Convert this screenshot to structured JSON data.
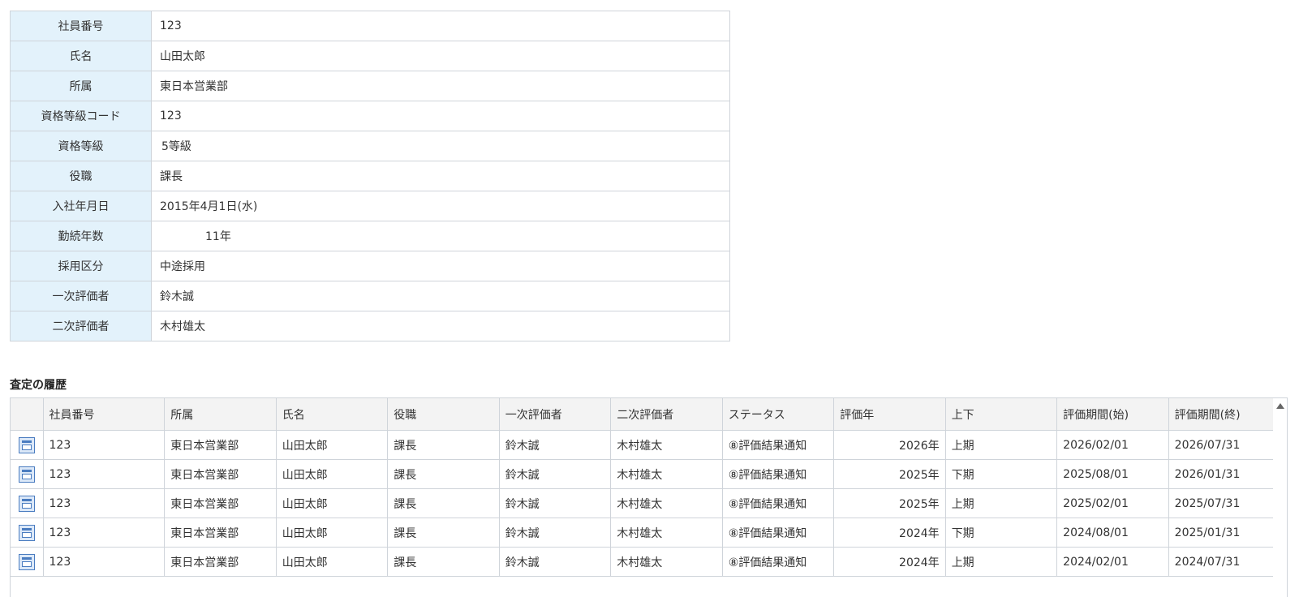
{
  "employee_info": [
    {
      "label": "社員番号",
      "value": "123"
    },
    {
      "label": "氏名",
      "value": "山田太郎"
    },
    {
      "label": "所属",
      "value": "東日本営業部"
    },
    {
      "label": "資格等級コード",
      "value": "123"
    },
    {
      "label": "資格等級",
      "value": "5等級"
    },
    {
      "label": "役職",
      "value": "課長"
    },
    {
      "label": "入社年月日",
      "value": "2015年4月1日(水)"
    },
    {
      "label": "勤続年数",
      "value": "11年"
    },
    {
      "label": "採用区分",
      "value": "中途採用"
    },
    {
      "label": "一次評価者",
      "value": "鈴木誠"
    },
    {
      "label": "二次評価者",
      "value": "木村雄太"
    }
  ],
  "history": {
    "title": "査定の履歴",
    "columns": [
      "社員番号",
      "所属",
      "氏名",
      "役職",
      "一次評価者",
      "二次評価者",
      "ステータス",
      "評価年",
      "上下",
      "評価期間(始)",
      "評価期間(終)"
    ],
    "rows": [
      [
        "123",
        "東日本営業部",
        "山田太郎",
        "課長",
        "鈴木誠",
        "木村雄太",
        "⑧評価結果通知",
        "2026年",
        "上期",
        "2026/02/01",
        "2026/07/31"
      ],
      [
        "123",
        "東日本営業部",
        "山田太郎",
        "課長",
        "鈴木誠",
        "木村雄太",
        "⑧評価結果通知",
        "2025年",
        "下期",
        "2025/08/01",
        "2026/01/31"
      ],
      [
        "123",
        "東日本営業部",
        "山田太郎",
        "課長",
        "鈴木誠",
        "木村雄太",
        "⑧評価結果通知",
        "2025年",
        "上期",
        "2025/02/01",
        "2025/07/31"
      ],
      [
        "123",
        "東日本営業部",
        "山田太郎",
        "課長",
        "鈴木誠",
        "木村雄太",
        "⑧評価結果通知",
        "2024年",
        "下期",
        "2024/08/01",
        "2025/01/31"
      ],
      [
        "123",
        "東日本営業部",
        "山田太郎",
        "課長",
        "鈴木誠",
        "木村雄太",
        "⑧評価結果通知",
        "2024年",
        "上期",
        "2024/02/01",
        "2024/07/31"
      ]
    ],
    "row_icon": "detail-form-icon",
    "scroll_icon": "scroll-up-arrow-icon"
  },
  "colors": {
    "label_bg": "#e3f2fb",
    "border": "#cfd4da",
    "header_bg": "#f3f3f3",
    "icon_accent": "#4a7cc0"
  }
}
